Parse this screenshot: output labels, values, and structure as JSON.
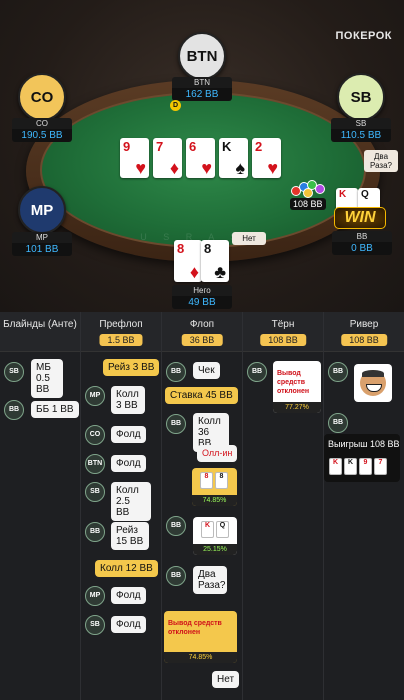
{
  "brand": "ПОКЕРОК",
  "table": {
    "felt_text": "U S R A S S",
    "seats": {
      "btn": {
        "pos": "BTN",
        "name": "BTN",
        "stack": "162 BB"
      },
      "co": {
        "pos": "CO",
        "name": "CO",
        "stack": "190.5 BB"
      },
      "sb": {
        "pos": "SB",
        "name": "SB",
        "stack": "110.5 BB"
      },
      "mp": {
        "pos": "MP",
        "name": "MP",
        "stack": "101 BB"
      },
      "bb": {
        "name": "BB",
        "stack": "0 BB"
      },
      "hero": {
        "name": "Него",
        "stack": "49 BB"
      }
    },
    "dealer": "D",
    "board": [
      {
        "rank": "9",
        "suit": "♥"
      },
      {
        "rank": "7",
        "suit": "♦"
      },
      {
        "rank": "6",
        "suit": "♥"
      },
      {
        "rank": "K",
        "suit": "♠"
      },
      {
        "rank": "2",
        "suit": "♥"
      }
    ],
    "hero_cards": [
      {
        "rank": "8",
        "suit": "♦"
      },
      {
        "rank": "8",
        "suit": "♣"
      }
    ],
    "bb_cards": [
      {
        "rank": "K",
        "suit": "♦"
      },
      {
        "rank": "Q",
        "suit": "♠"
      }
    ],
    "pot": "108 BB",
    "bb_bubble": "Два Раза?",
    "hero_bubble": "Нет",
    "win_badge": "WIN"
  },
  "history": {
    "columns": [
      {
        "title": "Блайнды (Анте)",
        "pot": ""
      },
      {
        "title": "Префлоп",
        "pot": "1.5 BB"
      },
      {
        "title": "Флоп",
        "pot": "36 BB"
      },
      {
        "title": "Тёрн",
        "pot": "108 BB"
      },
      {
        "title": "Ривер",
        "pot": "108 BB"
      }
    ],
    "blinds": [
      {
        "pos": "SB",
        "text": "МБ 0.5 BB"
      },
      {
        "pos": "BB",
        "text": "ББ 1 BB"
      }
    ],
    "preflop": [
      {
        "text": "Рейз 3 BB"
      },
      {
        "pos": "MP",
        "text": "Колл 3 BB"
      },
      {
        "pos": "CO",
        "text": "Фолд"
      },
      {
        "pos": "BTN",
        "text": "Фолд"
      },
      {
        "pos": "SB",
        "text": "Колл 2.5 BB"
      },
      {
        "pos": "BB",
        "text": "Рейз 15 BB"
      },
      {
        "text": "Колл 12 BB"
      },
      {
        "pos": "MP",
        "text": "Фолд"
      },
      {
        "pos": "SB",
        "text": "Фолд"
      }
    ],
    "flop": [
      {
        "pos": "BB",
        "text": "Чек"
      },
      {
        "text": "Ставка 45 BB"
      },
      {
        "pos": "BB",
        "text": "Колл 36 BB"
      },
      {
        "text": "Олл-ин"
      },
      {
        "equity": "74.85%",
        "cards": [
          "8",
          "8"
        ]
      },
      {
        "pos": "BB",
        "equity": "25.15%",
        "cards": [
          "K",
          "Q"
        ]
      },
      {
        "pos": "BB",
        "text": "Два Раза?"
      },
      {
        "withdraw": "Вывод средств отклонен",
        "equity": "74.85%"
      },
      {
        "text": "Нет"
      }
    ],
    "turn": [
      {
        "pos": "BB",
        "withdraw": "Вывод средств отклонен",
        "equity": "77.27%"
      }
    ],
    "river": [
      {
        "pos": "BB"
      },
      {
        "pos": "BB",
        "text": "Выигрыш 108 BB",
        "cards": [
          "K",
          "K",
          "9",
          "7"
        ]
      }
    ]
  },
  "colors": {
    "accent": "#f4c84c",
    "stack": "#3fb8ff",
    "felt": "#1f6e38"
  }
}
